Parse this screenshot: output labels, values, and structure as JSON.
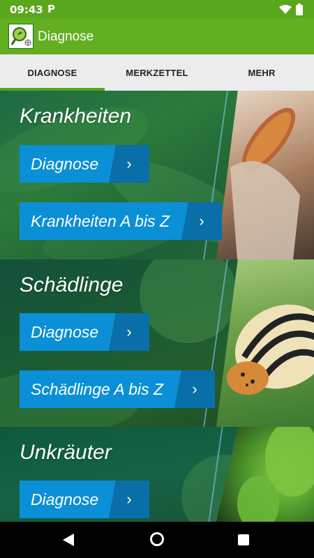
{
  "status_bar": {
    "time": "09:43",
    "notification_icon": "P"
  },
  "app_bar": {
    "title": "Diagnose",
    "logo_icon": "magnifier-plant-logo"
  },
  "tabs": [
    {
      "label": "DIAGNOSE",
      "active": true
    },
    {
      "label": "MERKZETTEL",
      "active": false
    },
    {
      "label": "MEHR",
      "active": false
    }
  ],
  "sections": [
    {
      "title": "Krankheiten",
      "buttons": [
        {
          "label": "Diagnose"
        },
        {
          "label": "Krankheiten A bis Z"
        }
      ],
      "image": "corn-cob-photo"
    },
    {
      "title": "Schädlinge",
      "buttons": [
        {
          "label": "Diagnose"
        },
        {
          "label": "Schädlinge A bis Z"
        }
      ],
      "image": "potato-beetle-photo"
    },
    {
      "title": "Unkräuter",
      "buttons": [
        {
          "label": "Diagnose"
        }
      ],
      "image": "weed-leaves-photo"
    }
  ],
  "colors": {
    "brand_green": "#62b021",
    "button_blue": "#0b8fd6",
    "button_arrow_blue": "#0a6ea8",
    "tab_indicator": "#52a81a"
  }
}
